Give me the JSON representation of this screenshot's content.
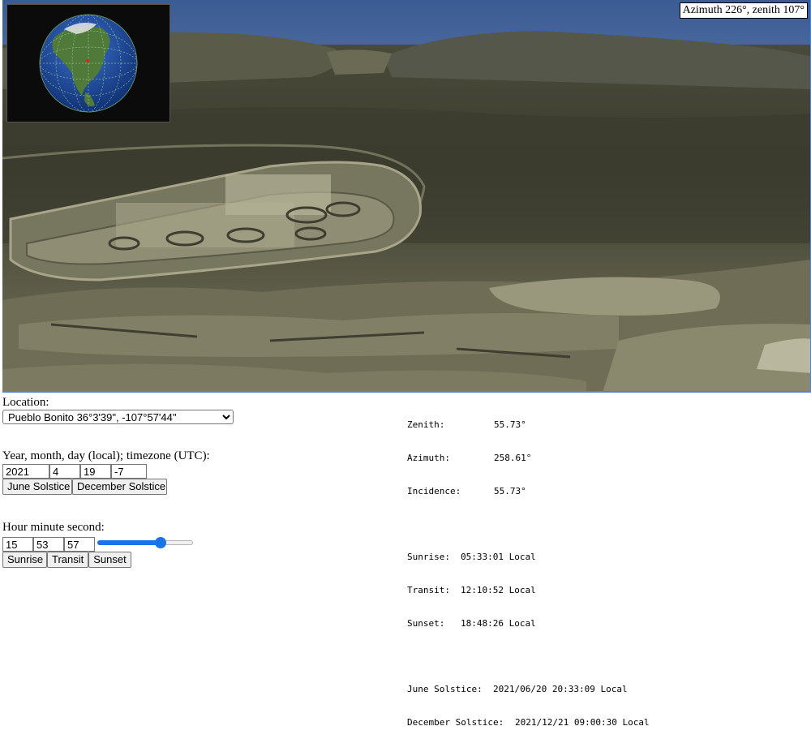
{
  "viewport": {
    "angle_readout": "Azimuth 226°, zenith 107°"
  },
  "globe": {
    "icon": "globe-icon"
  },
  "location": {
    "label": "Location:",
    "selected": "Pueblo Bonito 36°3'39\", -107°57'44\""
  },
  "date": {
    "label": "Year, month, day (local); timezone (UTC):",
    "year": "2021",
    "month": "4",
    "day": "19",
    "timezone": "-7",
    "june_button": "June Solstice",
    "december_button": "December Solstice"
  },
  "time": {
    "label": "Hour minute second:",
    "hour": "15",
    "minute": "53",
    "second": "57",
    "slider_fraction": 0.663,
    "sunrise_button": "Sunrise",
    "transit_button": "Transit",
    "sunset_button": "Sunset"
  },
  "readout": {
    "zenith_key": "Zenith:",
    "zenith_val": "55.73°",
    "azimuth_key": "Azimuth:",
    "azimuth_val": "258.61°",
    "incidence_key": "Incidence:",
    "incidence_val": "55.73°",
    "sunrise_key": "Sunrise:",
    "sunrise_val": "05:33:01 Local",
    "transit_key": "Transit:",
    "transit_val": "12:10:52 Local",
    "sunset_key": "Sunset:",
    "sunset_val": "18:48:26 Local",
    "june_key": "June Solstice:",
    "june_val": "2021/06/20 20:33:09 Local",
    "december_key": "December Solstice:",
    "december_val": "2021/12/21 09:00:30 Local"
  },
  "colors": {
    "sky": "#3f5f97",
    "slider_accent": "#1a73e8",
    "viewport_border": "#4a86d8"
  }
}
